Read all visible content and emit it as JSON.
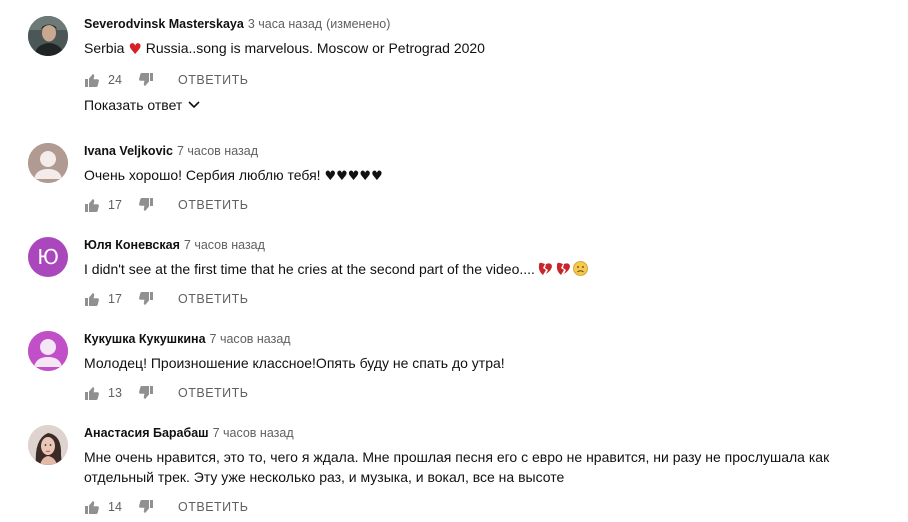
{
  "comments": [
    {
      "author": "Severodvinsk Masterskaya",
      "time": "3 часа назад",
      "edited": "(изменено)",
      "text_a": "Serbia",
      "text_b": " Russia..song is marvelous.  Moscow or Petrograd 2020",
      "likes": "24",
      "reply_label": "ОТВЕТИТЬ",
      "show_replies_label": "Показать ответ",
      "avatar_icon": "photo-avatar-man"
    },
    {
      "author": "Ivana Veljkovic",
      "time": "7 часов назад",
      "text": "Очень хорошо! Сербия люблю тебя! ",
      "hearts": "♥♥♥♥♥",
      "likes": "17",
      "reply_label": "ОТВЕТИТЬ",
      "avatar_color": "#b09a92"
    },
    {
      "author": "Юля Коневская",
      "time": "7 часов назад",
      "text": "I didn't see at the first time that he cries at the second part of the video....",
      "likes": "17",
      "reply_label": "ОТВЕТИТЬ",
      "avatar_letter": "Ю",
      "avatar_color": "#ab47bc"
    },
    {
      "author": "Кукушка Кукушкина",
      "time": "7 часов назад",
      "text": "Молодец! Произношение классное!Опять буду не спать до утра!",
      "likes": "13",
      "reply_label": "ОТВЕТИТЬ",
      "avatar_color": "#c150c8"
    },
    {
      "author": "Анастасия Барабаш",
      "time": "7 часов назад",
      "text": "Мне очень нравится, это то, чего я ждала. Мне прошлая песня его с евро не нравится, ни разу не прослушала как отдельный трек. Эту уже несколько раз, и музыка, и вокал, все на высоте",
      "likes": "14",
      "reply_label": "ОТВЕТИТЬ",
      "avatar_icon": "photo-avatar-woman"
    }
  ],
  "colors": {
    "secondary_text": "#606060",
    "primary_text": "#111111",
    "heart_red": "#d81f26"
  }
}
